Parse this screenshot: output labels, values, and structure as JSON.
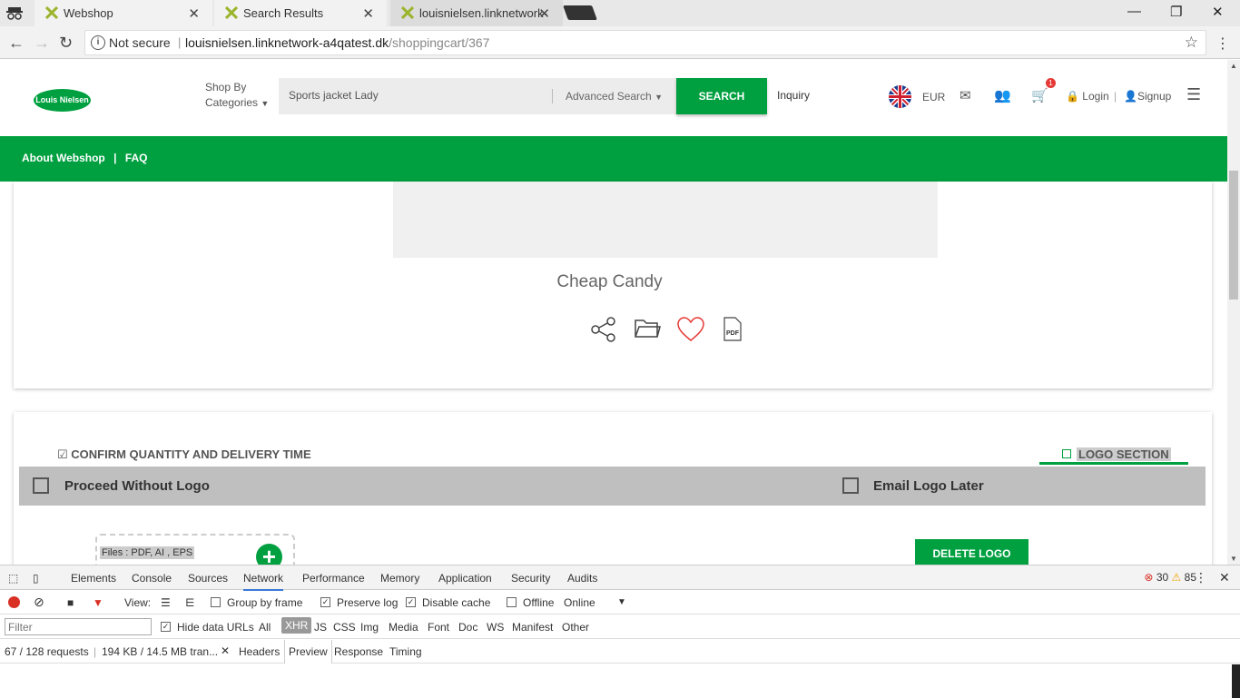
{
  "browser": {
    "tabs": [
      {
        "title": "Webshop",
        "icon": "louisnielsen-favicon"
      },
      {
        "title": "Search Results",
        "icon": "louisnielsen-favicon"
      },
      {
        "title": "louisnielsen.linknetwork-",
        "icon": "louisnielsen-favicon"
      }
    ],
    "security_label": "Not secure",
    "url_host": "louisnielsen.linknetwork-a4qatest.dk",
    "url_path": "/shoppingcart/367"
  },
  "header": {
    "logo_text": "Louis Nielsen",
    "shop_by_line1": "Shop By",
    "shop_by_line2": "Categories",
    "search_value": "Sports jacket Lady",
    "advanced_search": "Advanced Search",
    "search_button": "SEARCH",
    "inquiry": "Inquiry",
    "currency": "EUR",
    "cart_count": "1",
    "login": "Login",
    "separator": "|",
    "signup": "Signup"
  },
  "subnav": {
    "about": "About Webshop",
    "sep": "|",
    "faq": "FAQ"
  },
  "product": {
    "name": "Cheap Candy",
    "pdf_label": "PDF"
  },
  "logo_step": {
    "confirm_label": "CONFIRM QUANTITY AND DELIVERY TIME",
    "logo_section_label": "LOGO SECTION",
    "proceed_without_logo": "Proceed Without Logo",
    "email_logo_later": "Email Logo Later",
    "files_hint": "Files : PDF, AI , EPS",
    "delete_logo": "DELETE LOGO"
  },
  "devtools": {
    "tabs": [
      "Elements",
      "Console",
      "Sources",
      "Network",
      "Performance",
      "Memory",
      "Application",
      "Security",
      "Audits"
    ],
    "active_tab": "Network",
    "error_count": "30",
    "warning_count": "85",
    "toolbar": {
      "view_label": "View:",
      "group_by_frame": "Group by frame",
      "preserve_log": "Preserve log",
      "disable_cache": "Disable cache",
      "offline": "Offline",
      "online": "Online"
    },
    "filter": {
      "placeholder": "Filter",
      "hide_data_urls": "Hide data URLs",
      "types": [
        "All",
        "XHR",
        "JS",
        "CSS",
        "Img",
        "Media",
        "Font",
        "Doc",
        "WS",
        "Manifest",
        "Other"
      ],
      "active_type": "XHR"
    },
    "status": {
      "requests": "67 / 128 requests",
      "transferred": "194 KB / 14.5 MB tran...",
      "detail_tabs": [
        "Headers",
        "Preview",
        "Response",
        "Timing"
      ],
      "active_detail": "Preview"
    }
  },
  "colors": {
    "brand_green": "#00a040",
    "error": "#d93025",
    "warning": "#f2a600"
  }
}
